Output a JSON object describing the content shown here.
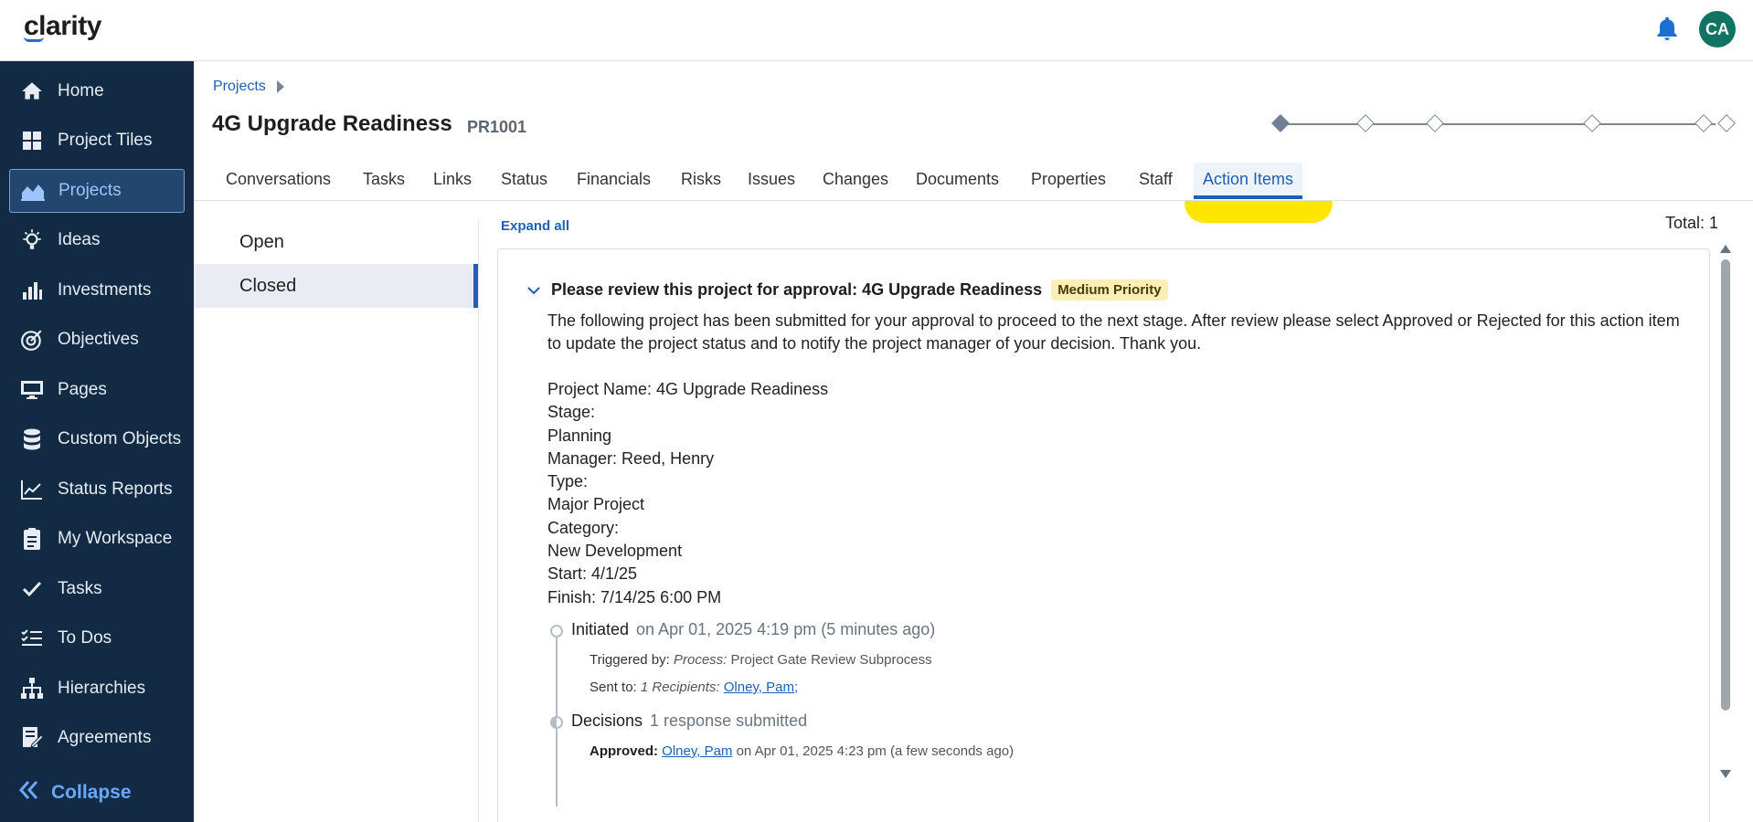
{
  "app": {
    "logo": "clarity",
    "user_initials": "CA"
  },
  "sidebar": {
    "items": [
      {
        "label": "Home",
        "icon": "home-icon"
      },
      {
        "label": "Project Tiles",
        "icon": "grid-icon"
      },
      {
        "label": "Projects",
        "icon": "projects-chart-icon",
        "active": true
      },
      {
        "label": "Ideas",
        "icon": "lightbulb-icon"
      },
      {
        "label": "Investments",
        "icon": "bar-chart-icon"
      },
      {
        "label": "Objectives",
        "icon": "target-icon"
      },
      {
        "label": "Pages",
        "icon": "monitor-icon"
      },
      {
        "label": "Custom Objects",
        "icon": "database-icon"
      },
      {
        "label": "Status Reports",
        "icon": "line-chart-icon"
      },
      {
        "label": "My Workspace",
        "icon": "clipboard-icon"
      },
      {
        "label": "Tasks",
        "icon": "check-icon"
      },
      {
        "label": "To Dos",
        "icon": "checklist-icon"
      },
      {
        "label": "Hierarchies",
        "icon": "hierarchy-icon"
      },
      {
        "label": "Agreements",
        "icon": "agreement-icon"
      }
    ],
    "collapse_label": "Collapse"
  },
  "header": {
    "breadcrumb": "Projects",
    "title": "4G Upgrade Readiness",
    "code": "PR1001"
  },
  "tabs": [
    "Conversations",
    "Tasks",
    "Links",
    "Status",
    "Financials",
    "Risks",
    "Issues",
    "Changes",
    "Documents",
    "Properties",
    "Staff",
    "Action Items"
  ],
  "active_tab": "Action Items",
  "status_filters": [
    "Open",
    "Closed"
  ],
  "active_filter": "Closed",
  "expand_all": "Expand all",
  "total": "Total: 1",
  "action_item": {
    "title": "Please review this project for approval: 4G Upgrade Readiness",
    "priority": "Medium Priority",
    "description": "The following project has been submitted for your approval to proceed to the next stage.  After review please select Approved or Rejected for this action item to update the project status and to notify the project manager of your decision.  Thank you.",
    "details": [
      "Project Name: 4G Upgrade Readiness",
      "Stage:",
      "Planning",
      "Manager: Reed, Henry",
      "Type:",
      "Major Project",
      "Category:",
      "New Development",
      "Start: 4/1/25",
      "Finish: 7/14/25 6:00 PM"
    ],
    "timeline": {
      "initiated": {
        "label": "Initiated",
        "when": "on Apr 01, 2025 4:19 pm (5 minutes ago)",
        "triggered_by_label": "Triggered by:",
        "triggered_by_type": "Process:",
        "triggered_by_value": "Project Gate Review Subprocess",
        "sent_to_label": "Sent to:",
        "sent_to_count": "1 Recipients:",
        "sent_to_value": "Olney, Pam;"
      },
      "decisions": {
        "label": "Decisions",
        "summary": "1 response submitted",
        "approved_label": "Approved:",
        "approved_by": "Olney, Pam",
        "approved_when": "on Apr 01, 2025 4:23 pm (a few seconds ago)"
      }
    }
  },
  "colors": {
    "sidebar_bg": "#122a44",
    "accent": "#1f5fb5",
    "avatar_bg": "#0f7461",
    "highlight": "#ffe600",
    "badge_bg": "#fbeeb8"
  }
}
